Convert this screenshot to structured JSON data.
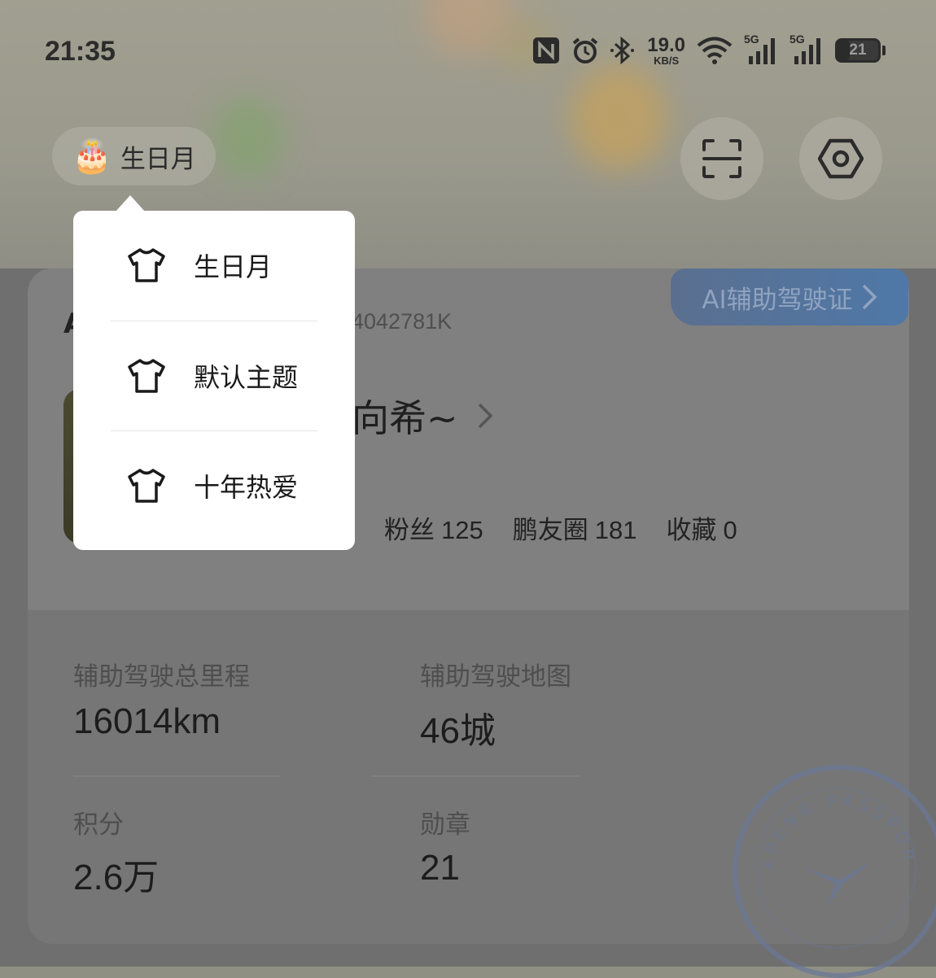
{
  "status_bar": {
    "time": "21:35",
    "net_speed_value": "19.0",
    "net_speed_unit": "KB/S",
    "sim1_label": "5G",
    "sim2_label": "5G",
    "battery_level": "21",
    "icons": [
      "nfc-icon",
      "alarm-icon",
      "bluetooth-icon",
      "wifi-icon",
      "signal-icon",
      "battery-icon"
    ]
  },
  "header": {
    "theme_chip_label": "生日月",
    "theme_chip_icon": "🎂"
  },
  "profile": {
    "ai_badge_label": "AI辅助驾驶证",
    "id_text": "4042781K",
    "initial": "A",
    "nickname": "向希~",
    "stats": [
      {
        "label": "粉丝",
        "value": "125"
      },
      {
        "label": "鹏友圈",
        "value": "181"
      },
      {
        "label": "收藏",
        "value": "0"
      }
    ]
  },
  "metrics": [
    {
      "label": "辅助驾驶总里程",
      "value": "16014km"
    },
    {
      "label": "辅助驾驶地图",
      "value": "46城"
    },
    {
      "label": "积分",
      "value": "2.6万"
    },
    {
      "label": "勋章",
      "value": "21"
    }
  ],
  "stamp": {
    "text": "XPENG PASSPORT"
  },
  "theme_menu": {
    "items": [
      {
        "label": "生日月"
      },
      {
        "label": "默认主题"
      },
      {
        "label": "十年热爱"
      }
    ]
  },
  "colors": {
    "overlay": "#6f6f6f",
    "menu_bg": "#ffffff",
    "badge_blue": "#4f78a8"
  }
}
